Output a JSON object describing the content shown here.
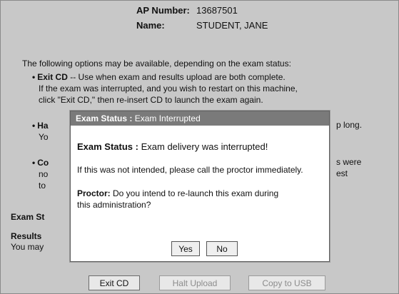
{
  "header": {
    "ap_label": "AP Number:",
    "ap_value": "13687501",
    "name_label": "Name:",
    "name_value": "STUDENT, JANE"
  },
  "intro": "The following options may be available, depending on the exam status:",
  "options": {
    "exit_cd": {
      "bullet": "•",
      "title": "Exit CD",
      "line1": " -- Use when exam and results upload are both complete.",
      "line2": "If the exam was interrupted, and you wish to restart on this machine,",
      "line3": "click \"Exit CD,\" then re-insert CD to launch the exam again."
    },
    "halt": {
      "bullet": "•",
      "title_fragment": "Ha",
      "line2_fragment": "Yo",
      "right_fragment": "p long."
    },
    "copy": {
      "bullet": "•",
      "title_fragment": "Co",
      "line2_fragment": "no",
      "line3_fragment": "to",
      "right_fragment1": "s were",
      "right_fragment2": "est"
    }
  },
  "status_heading_fragment": "Exam St",
  "results_heading_fragment": "Results",
  "results_text_fragment": "You may",
  "buttons": {
    "exit_cd": "Exit CD",
    "halt_upload": "Halt Upload",
    "copy_to_usb": "Copy to USB"
  },
  "modal": {
    "title_bold": "Exam Status :",
    "title_rest": " Exam Interrupted",
    "status_label": "Exam Status :",
    "status_text": " Exam delivery was interrupted!",
    "notice": "If this was not intended, please call the proctor immediately.",
    "proctor_label": "Proctor:",
    "proctor_text": " Do you intend to re-launch this exam during",
    "proctor_text2": "this administration?",
    "yes_label": "Yes",
    "no_label": "No"
  }
}
